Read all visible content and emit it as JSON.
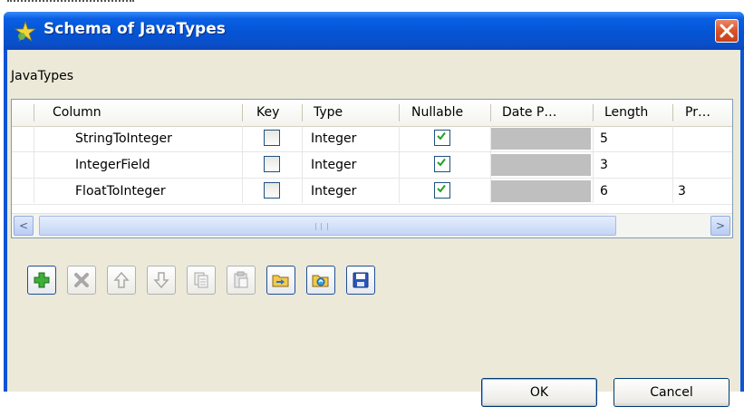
{
  "window": {
    "title": "Schema of JavaTypes",
    "section_label": "JavaTypes"
  },
  "table": {
    "columns": [
      "Column",
      "Key",
      "Type",
      "Nullable",
      "Date P…",
      "Length",
      "Pr…"
    ],
    "rows": [
      {
        "column": "StringToInteger",
        "key": false,
        "type": "Integer",
        "nullable": true,
        "date_pattern": "",
        "length": "5",
        "precision": ""
      },
      {
        "column": "IntegerField",
        "key": false,
        "type": "Integer",
        "nullable": true,
        "date_pattern": "",
        "length": "3",
        "precision": ""
      },
      {
        "column": "FloatToInteger",
        "key": false,
        "type": "Integer",
        "nullable": true,
        "date_pattern": "",
        "length": "6",
        "precision": "3"
      }
    ]
  },
  "scrollbar": {
    "left_arrow": "<",
    "right_arrow": ">"
  },
  "toolbar": {
    "buttons": [
      {
        "name": "add-icon",
        "enabled": true
      },
      {
        "name": "delete-icon",
        "enabled": false
      },
      {
        "name": "move-up-icon",
        "enabled": false
      },
      {
        "name": "move-down-icon",
        "enabled": false
      },
      {
        "name": "copy-icon",
        "enabled": false
      },
      {
        "name": "paste-icon",
        "enabled": false
      },
      {
        "name": "import-icon",
        "enabled": true
      },
      {
        "name": "export-icon",
        "enabled": true
      },
      {
        "name": "save-icon",
        "enabled": true
      }
    ]
  },
  "buttons": {
    "ok": "OK",
    "cancel": "Cancel"
  },
  "colors": {
    "titlebar": "#0454d4",
    "client_bg": "#ece9d8",
    "date_cell_disabled": "#bfbfbf",
    "check_green": "#21a121"
  }
}
